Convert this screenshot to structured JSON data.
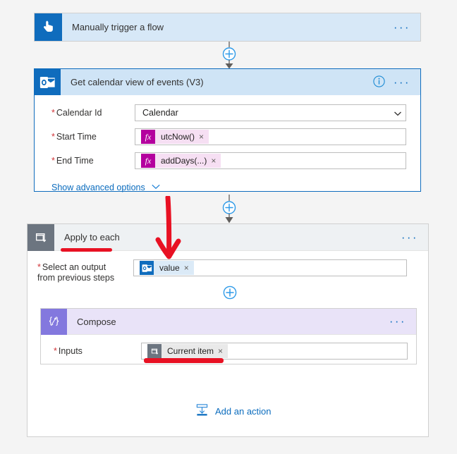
{
  "flow": {
    "trigger": {
      "title": "Manually trigger a flow",
      "icon": "tap-hand-icon",
      "icon_color": "#0f6cbd"
    },
    "outlook_action": {
      "title": "Get calendar view of events (V3)",
      "icon": "outlook-icon",
      "icon_color": "#0f6cbd",
      "border_color": "#0f6cbd",
      "info_label": "i",
      "menu_label": "· · ·",
      "fields": [
        {
          "label": "Calendar Id",
          "required": true,
          "type": "dropdown",
          "value": "Calendar"
        },
        {
          "label": "Start Time",
          "required": true,
          "type": "token",
          "token": {
            "text": "utcNow()",
            "icon": "fx-icon",
            "icon_text": "fx",
            "remove": "×"
          }
        },
        {
          "label": "End Time",
          "required": true,
          "type": "token",
          "token": {
            "text": "addDays(...)",
            "icon": "fx-icon",
            "icon_text": "fx",
            "remove": "×"
          }
        }
      ],
      "advanced_options": "Show advanced options"
    },
    "apply_to_each": {
      "title": "Apply to each",
      "icon": "loop-icon",
      "icon_color": "#6c7580",
      "menu_label": "· · ·",
      "select_output": {
        "label_line1": "Select an output",
        "label_line2": "from previous steps",
        "required": true,
        "token": {
          "text": "value",
          "icon": "outlook-icon",
          "remove": "×"
        }
      },
      "compose": {
        "title": "Compose",
        "icon": "compose-braces-icon",
        "icon_color": "#8378de",
        "menu_label": "· · ·",
        "inputs_label": "Inputs",
        "inputs_required": true,
        "token": {
          "text": "Current item",
          "icon": "loop-icon",
          "remove": "×"
        }
      },
      "add_action": {
        "label": "Add an action",
        "icon": "insert-action-icon"
      }
    }
  },
  "annotations": {
    "arrow_color": "#e81123",
    "underline_color": "#e81123",
    "items": [
      {
        "name": "red-arrow-to-value-token",
        "type": "arrow"
      },
      {
        "name": "red-underline-apply-to-each",
        "type": "underline"
      },
      {
        "name": "red-underline-current-item",
        "type": "underline"
      }
    ]
  }
}
